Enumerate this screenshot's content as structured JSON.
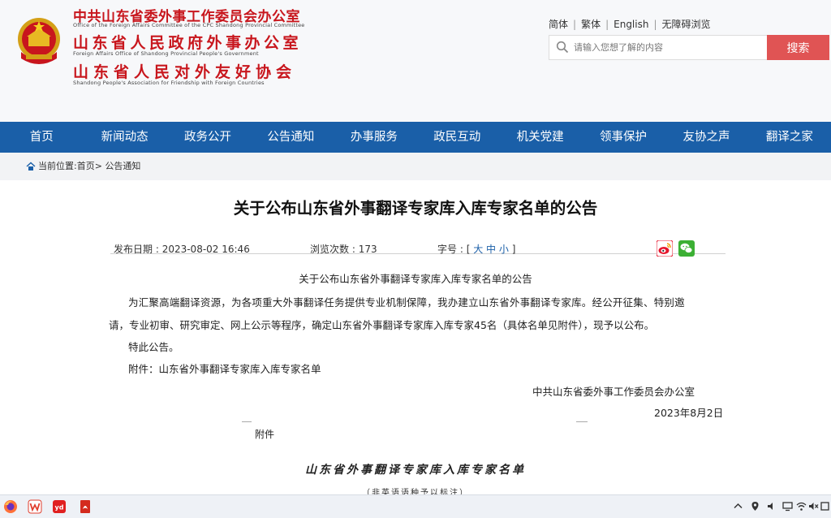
{
  "header": {
    "org_cn_1": "中共山东省委外事工作委员会办公室",
    "org_en_1": "Office of the Foreign Affairs Committee of the CPC Shandong Provincial Committee",
    "org_cn_2": "山东省人民政府外事办公室",
    "org_en_2": "Foreign Affairs Office of Shandong Provincial People's Government",
    "org_cn_3": "山东省人民对外友好协会",
    "org_en_3": "Shandong People's Association for Friendship with Foreign Countries",
    "lang_links": [
      "简体",
      "繁体",
      "English",
      "无障碍浏览"
    ],
    "search_placeholder": "请输入您想了解的内容",
    "search_button": "搜索"
  },
  "nav": [
    "首页",
    "新闻动态",
    "政务公开",
    "公告通知",
    "办事服务",
    "政民互动",
    "机关党建",
    "领事保护",
    "友协之声",
    "翻译之家"
  ],
  "breadcrumb": {
    "label": "当前位置:",
    "home": "首页",
    "separator": ">",
    "current": "公告通知"
  },
  "article": {
    "title": "关于公布山东省外事翻译专家库入库专家名单的公告",
    "publish_label": "发布日期 : ",
    "publish_date": "2023-08-02 16:46",
    "views_label": "浏览次数 : ",
    "views": "173",
    "font_label": "字号 : ",
    "font_sizes": [
      "大",
      "中",
      "小"
    ],
    "subtitle": "关于公布山东省外事翻译专家库入库专家名单的公告",
    "para1_line1": "为汇聚高端翻译资源，为各项重大外事翻译任务提供专业机制保障，我办建立山东省外事翻译专家库。经公开征集、特别邀",
    "para1_line2": "请，专业初审、研究审定、网上公示等程序，确定山东省外事翻译专家库入库专家45名（具体名单见附件），现予以公布。",
    "para2": "特此公告。",
    "attachment_line": "附件：山东省外事翻译专家库入库专家名单",
    "signature_org": "中共山东省委外事工作委员会办公室",
    "signature_date": "2023年8月2日",
    "attachment_heading": "附件",
    "scan_title": "山东省外事翻译专家库入库专家名单",
    "scan_subtitle": "（非英语语种予以标注）"
  },
  "colors": {
    "brand_red": "#c8161d",
    "nav_blue": "#1a5fa8",
    "search_red": "#e05454"
  },
  "icons": {
    "emblem": "national-emblem",
    "search": "magnifier",
    "home": "house",
    "share": [
      "weibo",
      "wechat"
    ],
    "taskbar_apps": [
      "firefox",
      "wps",
      "youdao",
      "pdf-reader"
    ],
    "tray": [
      "chevron-up",
      "location",
      "audio",
      "display",
      "wifi",
      "ime",
      "volume-muted",
      "notification"
    ]
  }
}
